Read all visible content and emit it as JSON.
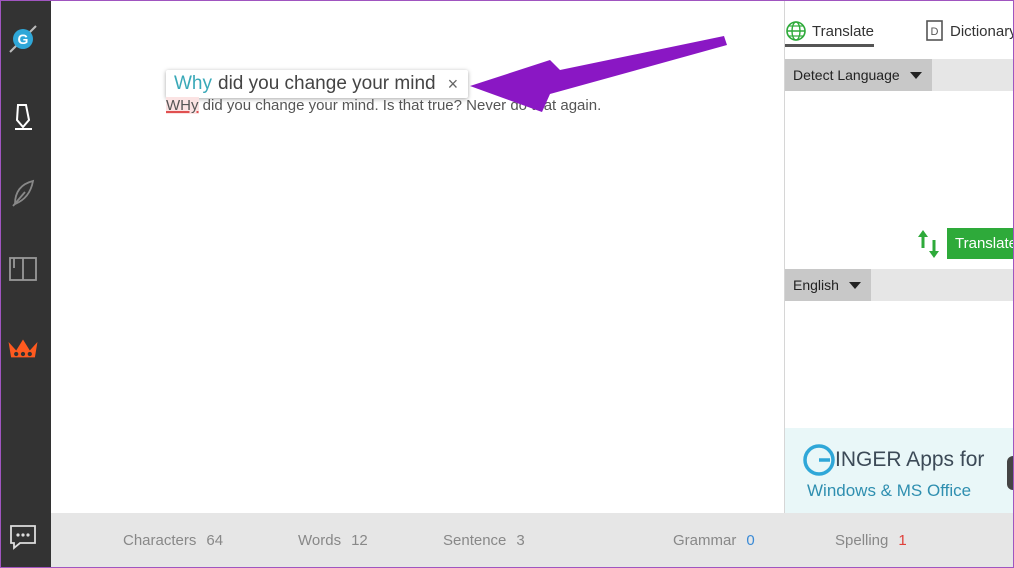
{
  "sidebar": {
    "items": [
      "ginger-logo",
      "pen-icon",
      "feather-icon",
      "book-icon",
      "crown-icon",
      "chat-icon"
    ]
  },
  "editor": {
    "suggestion": {
      "highlight": "Why",
      "rest": "did you change your mind",
      "close": "×"
    },
    "text": {
      "error_word": "WHy",
      "rest": " did you change your mind. Is that true? Never do that again."
    }
  },
  "right_panel": {
    "tabs": [
      {
        "label": "Translate",
        "active": true
      },
      {
        "label": "Dictionary",
        "active": false
      }
    ],
    "source_language": "Detect Language",
    "target_language": "English",
    "translate_button": "Translate",
    "ad": {
      "logo_letter": "G",
      "line1": "INGER Apps for",
      "line2": "Windows & MS Office"
    }
  },
  "status": {
    "characters_label": "Characters",
    "characters_value": "64",
    "words_label": "Words",
    "words_value": "12",
    "sentence_label": "Sentence",
    "sentence_value": "3",
    "grammar_label": "Grammar",
    "grammar_value": "0",
    "spelling_label": "Spelling",
    "spelling_value": "1"
  },
  "colors": {
    "sidebar_bg": "#333333",
    "accent_crown": "#ff5a1f",
    "suggestion_highlight": "#3aa9b8",
    "translate_green": "#2eaa3a",
    "annotation_arrow": "#8a17c4",
    "grammar_blue": "#3a8ad6",
    "spelling_red": "#e0403a"
  }
}
